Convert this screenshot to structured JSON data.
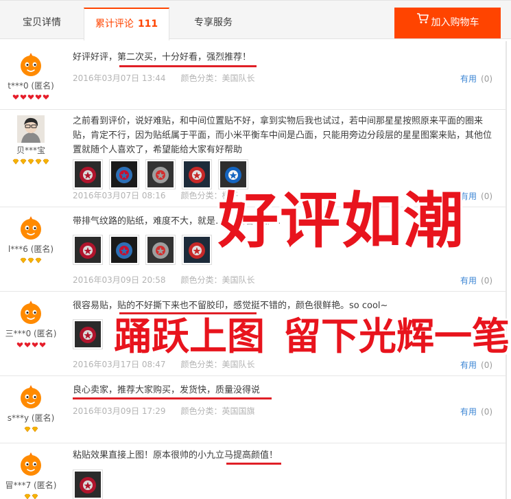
{
  "tabs": {
    "detail": "宝贝详情",
    "reviews": "累计评论",
    "reviews_count": "111",
    "service": "专享服务"
  },
  "cart": {
    "label": "加入购物车",
    "icon": "cart-icon"
  },
  "reviews": [
    {
      "user": "t***0 (匿名)",
      "avatar": "taobao-mascot",
      "badges": [
        "red-heart",
        "red-heart",
        "red-heart",
        "red-heart",
        "red-heart"
      ],
      "text": "好评好评，第二次买，十分好看，强烈推荐！",
      "date": "2016年03月07日 13:44",
      "sku": "颜色分类：美国队长",
      "useful_label": "有用",
      "useful_count": "(0)"
    },
    {
      "user": "贝***宝",
      "avatar": "user-photo",
      "badges": [
        "diamond",
        "diamond",
        "diamond",
        "diamond",
        "diamond"
      ],
      "text": "之前看到评价，说好难贴，和中间位置贴不好，拿到实物后我也试过，若中间那星星按照原来平面的圈来贴，肯定不行，因为贴纸属于平面，而小米平衡车中间是凸面，只能用旁边分段层的星星图案来贴，其他位置就随个人喜欢了，希望能给大家有好帮助",
      "thumbs": [
        "photo",
        "photo",
        "photo",
        "photo",
        "photo"
      ],
      "date": "2016年03月07日 08:16",
      "sku": "颜色分类：橙子",
      "useful_label": "有用",
      "useful_count": "(0)"
    },
    {
      "user": "l***6 (匿名)",
      "avatar": "taobao-mascot",
      "badges": [
        "diamond",
        "diamond",
        "diamond"
      ],
      "text": "带排气纹路的贴纸，难度不大，就是… …后看…那…",
      "thumbs": [
        "photo",
        "photo",
        "photo",
        "photo"
      ],
      "date": "2016年03月09日 20:58",
      "sku": "颜色分类：美国队长",
      "useful_label": "有用",
      "useful_count": "(0)"
    },
    {
      "user": "三***0 (匿名)",
      "avatar": "taobao-mascot",
      "badges": [
        "red-heart",
        "red-heart",
        "red-heart",
        "red-heart"
      ],
      "text": "很容易贴，贴的不好撕下来也不留胶印，感觉挺不错的，颜色很鲜艳。so cool~",
      "thumbs": [
        "photo"
      ],
      "date": "2016年03月17日 08:47",
      "sku": "颜色分类：美国队长",
      "useful_label": "有用",
      "useful_count": "(0)"
    },
    {
      "user": "s***y (匿名)",
      "avatar": "taobao-mascot",
      "badges": [
        "diamond",
        "diamond"
      ],
      "text": "良心卖家，推荐大家购买，发货快，质量没得说",
      "date": "2016年03月09日 17:29",
      "sku": "颜色分类：英国国旗",
      "useful_label": "有用",
      "useful_count": "(0)"
    },
    {
      "user": "冒***7 (匿名)",
      "avatar": "taobao-mascot",
      "badges": [
        "diamond",
        "diamond"
      ],
      "text": "粘贴效果直接上图！原本很帅的小九立马提高颜值！",
      "thumbs": [
        "photo"
      ]
    }
  ],
  "overlay": {
    "slogan1": "好评如潮",
    "slogan2": "踊跃上图",
    "slogan3": "留下光辉一笔"
  },
  "colors": {
    "accent": "#ff4400",
    "link": "#3c86d4",
    "muted": "#b3b3b3",
    "underline": "#e01f26",
    "slogan": "#e8141d"
  }
}
